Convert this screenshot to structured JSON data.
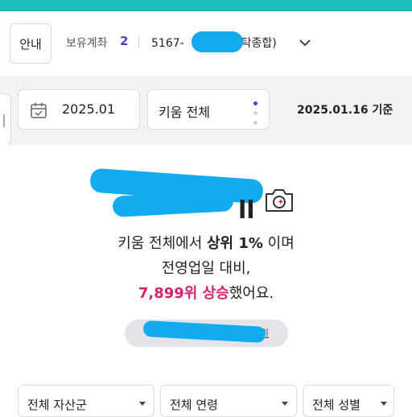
{
  "header": {
    "guide_label": "안내",
    "holdings_label": "보유계좌",
    "holdings_count": "2",
    "account_prefix": "5167-",
    "account_suffix": "위탁종합)"
  },
  "filters": {
    "date": "2025.01",
    "scope": "키움 전체",
    "basis_date": "2025.01.16 기준"
  },
  "summary": {
    "line1_a": "키움 전체에서 ",
    "line1_b": "상위 1%",
    "line1_c": " 이며",
    "line2": "전영업일 대비,",
    "line3_hl": "7,899위 상승",
    "line3_rest": "했어요.",
    "pill_tail": "위"
  },
  "segments": [
    {
      "label": "전체 자산군"
    },
    {
      "label": "전체 연령"
    },
    {
      "label": "전체 성별"
    }
  ],
  "colors": {
    "topbar": "#1dbdbd",
    "accent_purple": "#5b3cc4",
    "highlight_pink": "#d6246e",
    "redaction": "#14aaf0"
  },
  "icons": [
    "calendar-icon",
    "chevron-down-icon",
    "camera-sparkle-icon",
    "caret-down-icon",
    "more-dots-icon"
  ]
}
